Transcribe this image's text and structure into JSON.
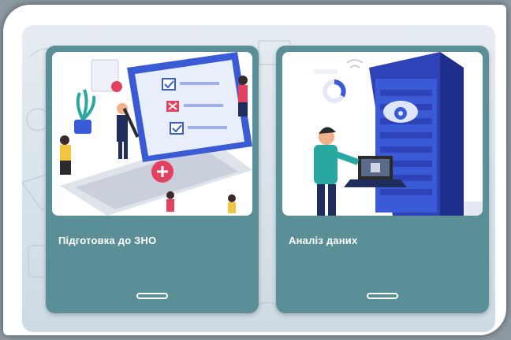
{
  "cards": [
    {
      "title": "Підготовка до ЗНО",
      "image_icon": "exam-checklist-illustration",
      "handle_icon": "expand-handle-icon"
    },
    {
      "title": "Аналіз даних",
      "image_icon": "server-data-illustration",
      "handle_icon": "expand-handle-icon"
    }
  ],
  "colors": {
    "card": "#5a8f98",
    "accent_red": "#e4405f",
    "accent_blue": "#3b5bd6"
  }
}
